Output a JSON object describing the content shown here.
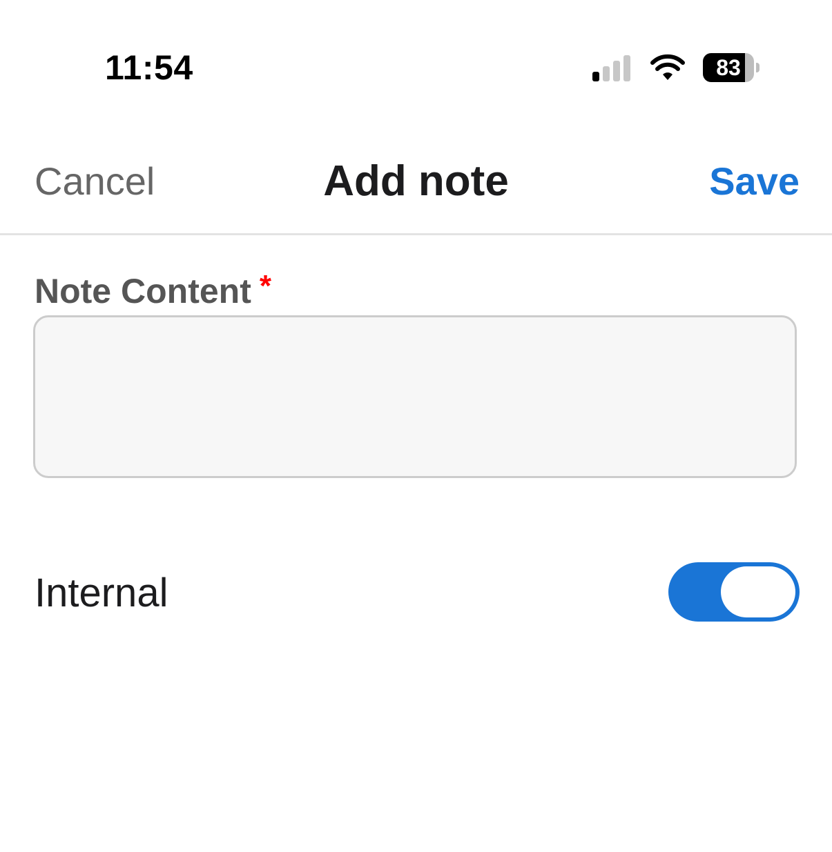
{
  "status_bar": {
    "time": "11:54",
    "battery_level": "83",
    "signal_icon": "cellular-signal-icon",
    "wifi_icon": "wifi-icon"
  },
  "header": {
    "cancel_label": "Cancel",
    "title": "Add note",
    "save_label": "Save"
  },
  "form": {
    "note_content": {
      "label": "Note Content",
      "required_mark": "*",
      "value": ""
    },
    "internal": {
      "label": "Internal",
      "enabled": true
    }
  },
  "colors": {
    "accent": "#1a75d6",
    "required": "#ff0000",
    "label_gray": "#555555",
    "cancel_gray": "#666666",
    "field_background": "#f7f7f7",
    "field_border": "#cccccc"
  }
}
